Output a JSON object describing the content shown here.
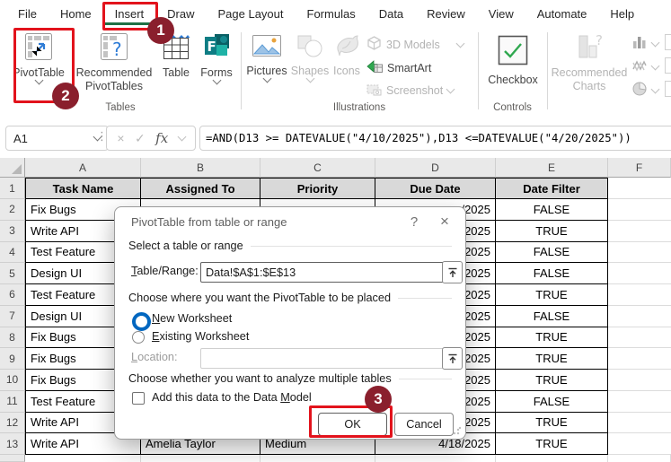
{
  "colors": {
    "annotation_red": "#e2131c",
    "badge_maroon": "#8a1f2d",
    "accent_green": "#1e7145",
    "radio_blue": "#0067c0",
    "header_fill": "#d9d9d9"
  },
  "annotations": {
    "one": "1",
    "two": "2",
    "three": "3"
  },
  "ribbon": {
    "tabs": [
      "File",
      "Home",
      "Insert",
      "Draw",
      "Page Layout",
      "Formulas",
      "Data",
      "Review",
      "View",
      "Automate",
      "Help"
    ],
    "active_tab": "Insert",
    "tables": {
      "label": "Tables",
      "pivottable": "PivotTable",
      "recommended_pivottables": "Recommended PivotTables",
      "table": "Table",
      "forms": "Forms"
    },
    "illustrations": {
      "label": "Illustrations",
      "pictures": "Pictures",
      "shapes": "Shapes",
      "icons": "Icons",
      "models3d": "3D Models",
      "smartart": "SmartArt",
      "screenshot": "Screenshot"
    },
    "controls": {
      "label": "Controls",
      "checkbox": "Checkbox"
    },
    "charts": {
      "recommended_charts": "Recommended Charts"
    }
  },
  "formula_bar": {
    "name_box": "A1",
    "cancel": "×",
    "enter": "✓",
    "fx": "fx",
    "formula": "=AND(D13 >= DATEVALUE(\"4/10/2025\"),D13 <=DATEVALUE(\"4/20/2025\"))"
  },
  "sheet": {
    "column_letters": [
      "A",
      "B",
      "C",
      "D",
      "E",
      "F"
    ],
    "headers": [
      "Task Name",
      "Assigned To",
      "Priority",
      "Due Date",
      "Date Filter"
    ],
    "rows": [
      {
        "n": "2",
        "task": "Fix Bugs",
        "assigned": "",
        "priority": "",
        "due": "/2025",
        "filter": "FALSE"
      },
      {
        "n": "3",
        "task": "Write API",
        "assigned": "",
        "priority": "",
        "due": "/2025",
        "filter": "TRUE"
      },
      {
        "n": "4",
        "task": "Test Feature",
        "assigned": "",
        "priority": "",
        "due": "/2025",
        "filter": "FALSE"
      },
      {
        "n": "5",
        "task": "Design UI",
        "assigned": "",
        "priority": "",
        "due": "/2025",
        "filter": "FALSE"
      },
      {
        "n": "6",
        "task": "Test Feature",
        "assigned": "",
        "priority": "",
        "due": "/2025",
        "filter": "TRUE"
      },
      {
        "n": "7",
        "task": "Design UI",
        "assigned": "",
        "priority": "",
        "due": "/2025",
        "filter": "FALSE"
      },
      {
        "n": "8",
        "task": "Fix Bugs",
        "assigned": "",
        "priority": "",
        "due": "/2025",
        "filter": "TRUE"
      },
      {
        "n": "9",
        "task": "Fix Bugs",
        "assigned": "",
        "priority": "",
        "due": "/2025",
        "filter": "TRUE"
      },
      {
        "n": "10",
        "task": "Fix Bugs",
        "assigned": "",
        "priority": "",
        "due": "/2025",
        "filter": "TRUE"
      },
      {
        "n": "11",
        "task": "Test Feature",
        "assigned": "",
        "priority": "",
        "due": "/2025",
        "filter": "FALSE"
      },
      {
        "n": "12",
        "task": "Write API",
        "assigned": "",
        "priority": "",
        "due": "/2025",
        "filter": "TRUE"
      },
      {
        "n": "13",
        "task": "Write API",
        "assigned": "Amelia Taylor",
        "priority": "Medium",
        "due": "4/18/2025",
        "filter": "TRUE"
      }
    ]
  },
  "dialog": {
    "title": "PivotTable from table or range",
    "help": "?",
    "close": "×",
    "section1": "Select a table or range",
    "table_range_label": {
      "u": "T",
      "post": "able/Range:"
    },
    "table_range_value": "Data!$A$1:$E$13",
    "section2": "Choose where you want the PivotTable to be placed",
    "radio_new": {
      "u": "N",
      "post": "ew Worksheet"
    },
    "radio_existing": {
      "u": "E",
      "post": "xisting Worksheet"
    },
    "location_label": {
      "u": "L",
      "post": "ocation:"
    },
    "location_value": "",
    "section3": "Choose whether you want to analyze multiple tables",
    "checkbox_label": {
      "pre": "Add this data to the Data ",
      "u": "M",
      "post": "odel"
    },
    "ok": "OK",
    "cancel": "Cancel"
  }
}
